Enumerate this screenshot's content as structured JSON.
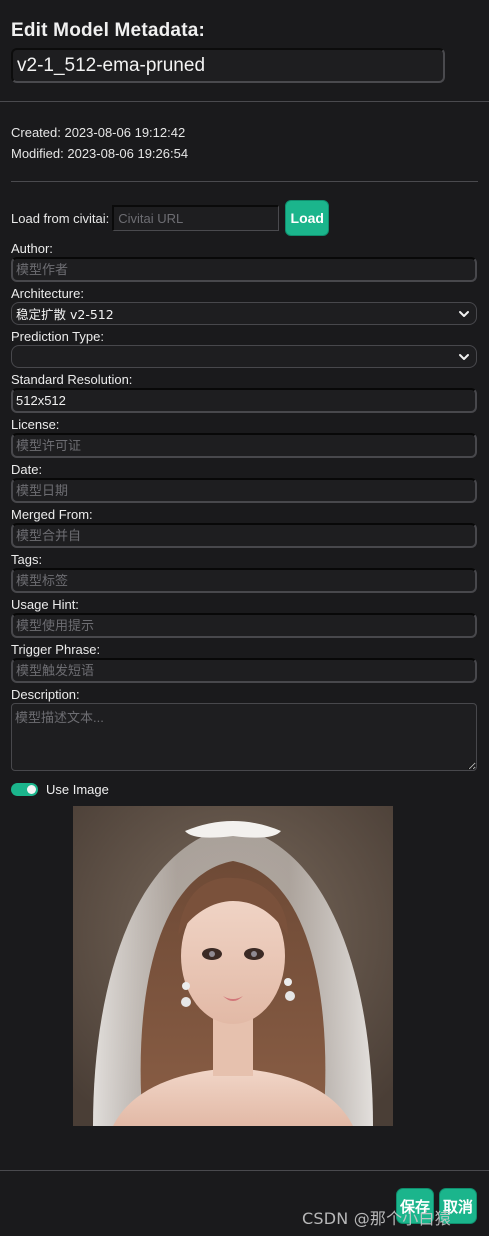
{
  "header": {
    "title": "Edit Model Metadata:",
    "model_name": "v2-1_512-ema-pruned"
  },
  "meta": {
    "created": "Created: 2023-08-06 19:12:42",
    "modified": "Modified: 2023-08-06 19:26:54"
  },
  "civitai": {
    "label": "Load from civitai:",
    "placeholder": "Civitai URL",
    "load_label": "Load"
  },
  "fields": {
    "author": {
      "label": "Author:",
      "value": "",
      "placeholder": "模型作者"
    },
    "architecture": {
      "label": "Architecture:",
      "value": "稳定扩散 v2-512"
    },
    "prediction_type": {
      "label": "Prediction Type:",
      "value": ""
    },
    "standard_resolution": {
      "label": "Standard Resolution:",
      "value": "512x512",
      "placeholder": ""
    },
    "license": {
      "label": "License:",
      "value": "",
      "placeholder": "模型许可证"
    },
    "date": {
      "label": "Date:",
      "value": "",
      "placeholder": "模型日期"
    },
    "merged_from": {
      "label": "Merged From:",
      "value": "",
      "placeholder": "模型合并自"
    },
    "tags": {
      "label": "Tags:",
      "value": "",
      "placeholder": "模型标签"
    },
    "usage_hint": {
      "label": "Usage Hint:",
      "value": "",
      "placeholder": "模型使用提示"
    },
    "trigger_phrase": {
      "label": "Trigger Phrase:",
      "value": "",
      "placeholder": "模型触发短语"
    },
    "description": {
      "label": "Description:",
      "placeholder": "模型描述文本..."
    }
  },
  "use_image": {
    "label": "Use Image",
    "enabled": true
  },
  "footer": {
    "save_label": "保存",
    "cancel_label": "取消",
    "watermark": "CSDN @那个小白猿"
  },
  "colors": {
    "accent": "#1bb58c",
    "background": "#1a1a1c"
  }
}
